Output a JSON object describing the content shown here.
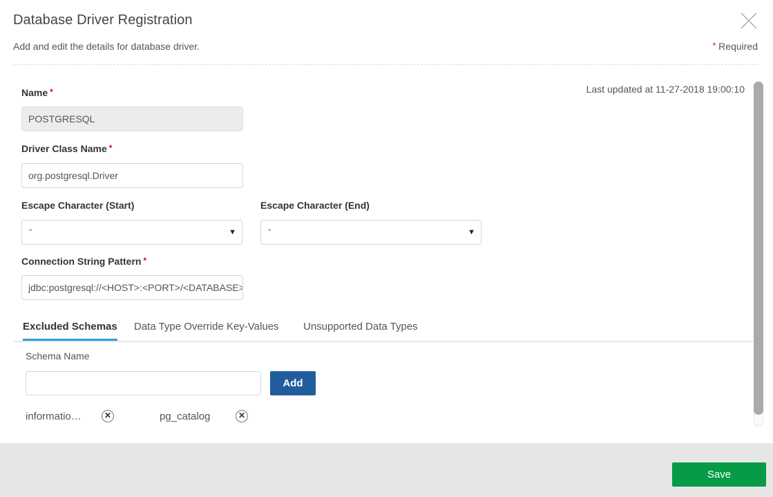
{
  "dialog": {
    "title": "Database Driver Registration",
    "subtitle": "Add and edit the details for database driver.",
    "required_star": "*",
    "required_label": "Required",
    "last_updated": "Last updated at 11-27-2018 19:00:10"
  },
  "form": {
    "name": {
      "label": "Name",
      "required": "*",
      "value": "POSTGRESQL"
    },
    "driver_class": {
      "label": "Driver Class Name",
      "required": "*",
      "value": "org.postgresql.Driver"
    },
    "escape_start": {
      "label": "Escape Character (Start)",
      "value": "\""
    },
    "escape_end": {
      "label": "Escape Character (End)",
      "value": "\""
    },
    "connection_string": {
      "label": "Connection String Pattern",
      "required": "*",
      "value": "jdbc:postgresql://<HOST>:<PORT>/<DATABASE>"
    }
  },
  "tabs": [
    {
      "label": "Excluded Schemas",
      "active": true
    },
    {
      "label": "Data Type Override Key-Values",
      "active": false
    },
    {
      "label": "Unsupported Data Types",
      "active": false
    }
  ],
  "excluded_schemas": {
    "field_label": "Schema Name",
    "input_value": "",
    "add_label": "Add",
    "items": [
      {
        "label": "informatio…"
      },
      {
        "label": "pg_catalog"
      }
    ]
  },
  "footer": {
    "save_label": "Save"
  },
  "colors": {
    "accent_tab": "#2a9fd6",
    "add_button": "#215d9c",
    "save_button": "#079b46",
    "required": "#d0021b"
  }
}
